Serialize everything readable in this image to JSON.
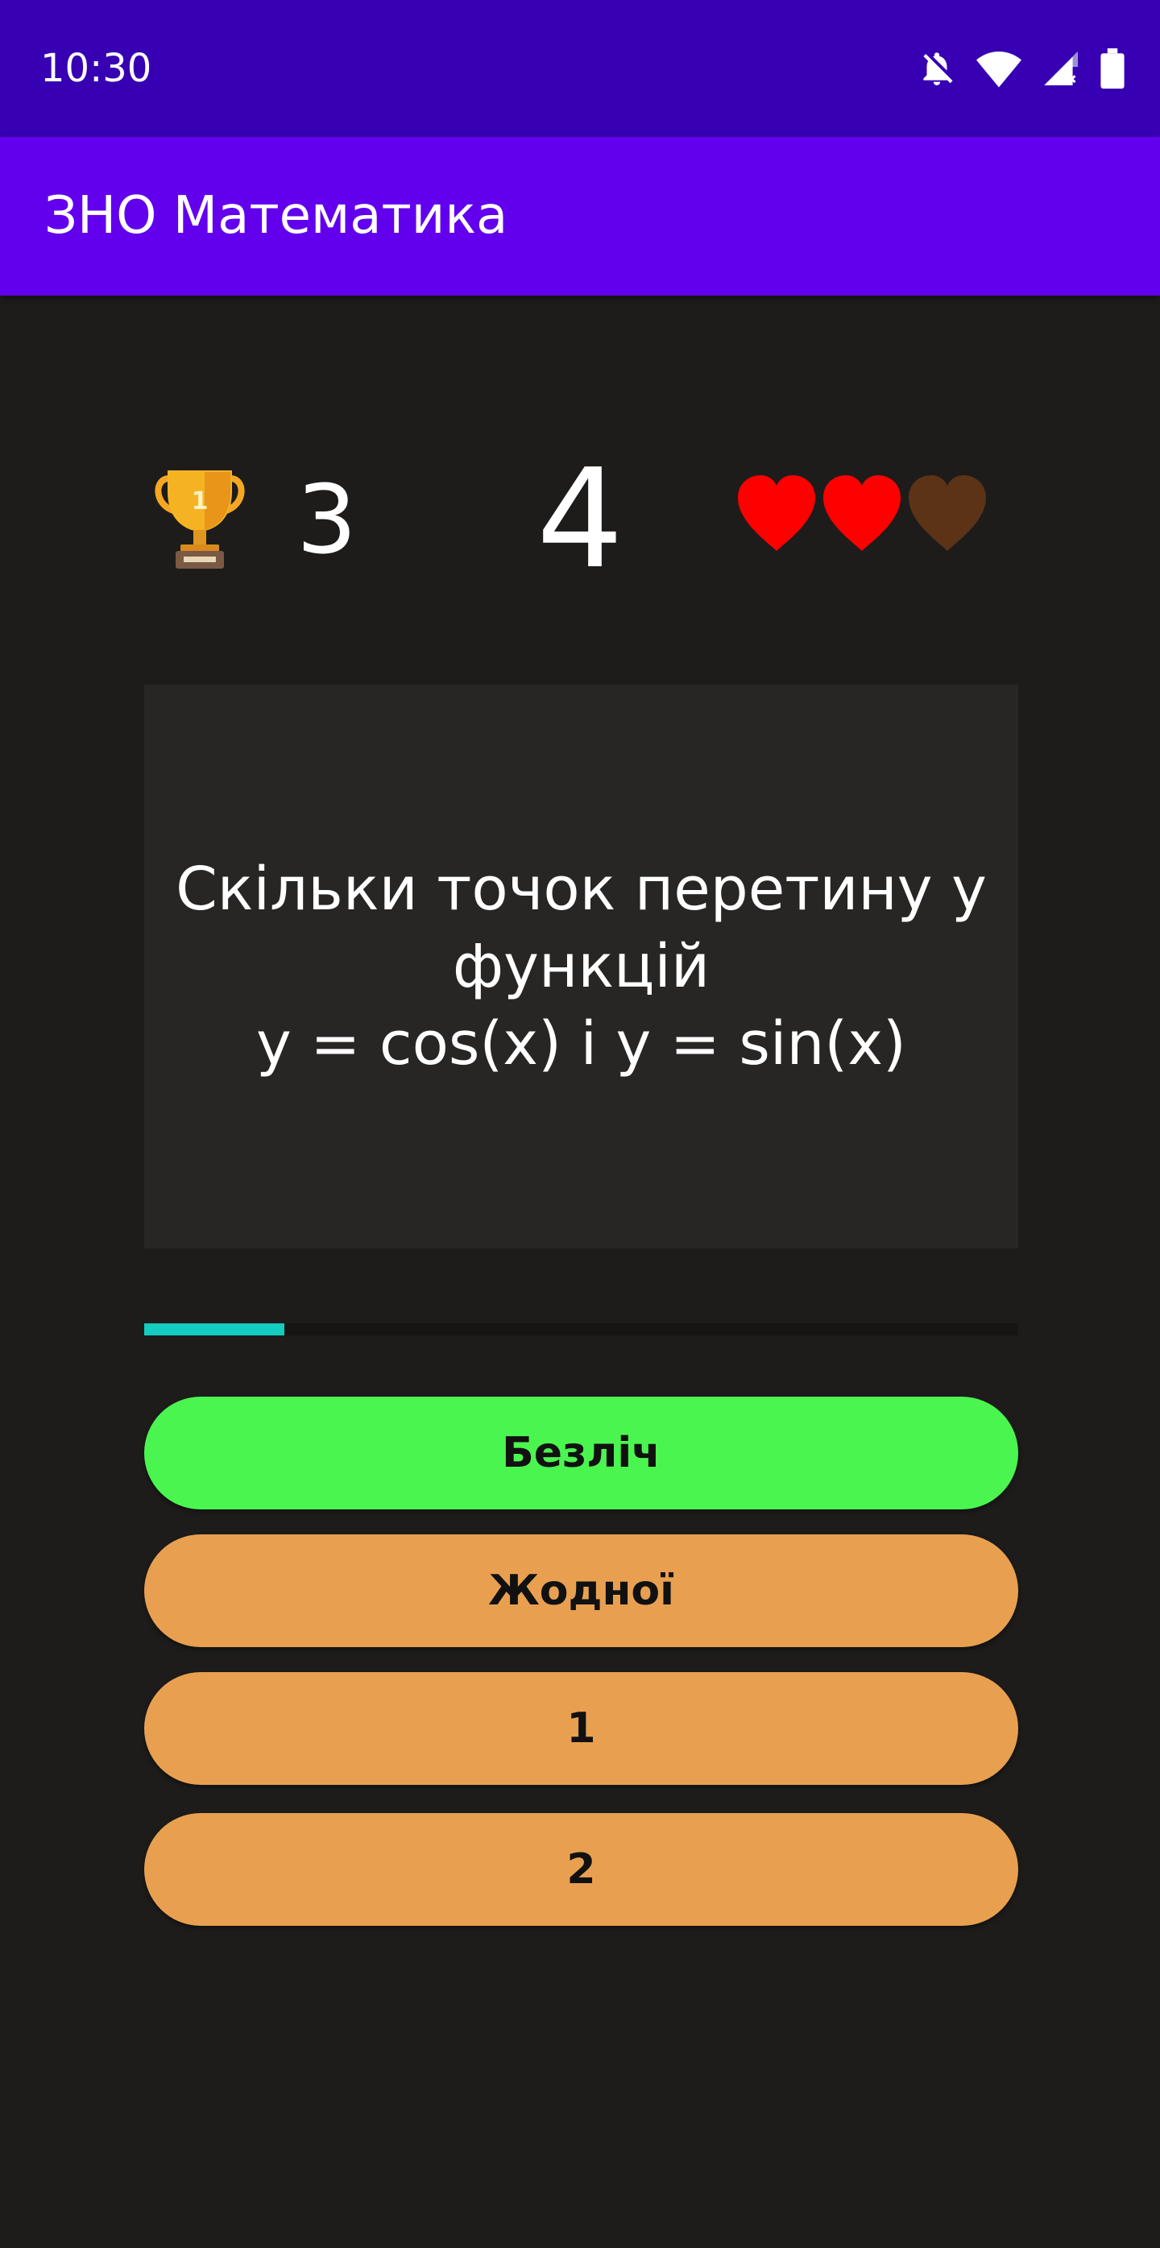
{
  "status_bar": {
    "time": "10:30",
    "icons": [
      "notifications-off-icon",
      "wifi-icon",
      "signal-no-service-icon",
      "battery-icon"
    ]
  },
  "app_bar": {
    "title": "ЗНО Математика"
  },
  "stats": {
    "trophy_icon": "trophy-icon",
    "score": "3",
    "question_number": "4",
    "lives_total": 3,
    "lives_remaining": 2,
    "heart_full_color": "#ff0000",
    "heart_empty_color": "#5c3317"
  },
  "question": {
    "text": "Скільки точок перетину у функцій\ny = cos(x) і y = sin(x)"
  },
  "timer": {
    "progress_fraction": 0.16,
    "color": "#14ccc0"
  },
  "answers": [
    {
      "label": "Безліч",
      "color": "#4bf550"
    },
    {
      "label": "Жодної",
      "color": "#e8a050"
    },
    {
      "label": "1",
      "color": "#e8a050"
    },
    {
      "label": "2",
      "color": "#e8a050"
    }
  ]
}
